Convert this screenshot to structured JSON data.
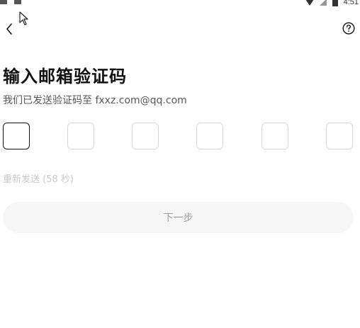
{
  "status_bar": {
    "time": "4:51",
    "left_icons": [
      "notification-icon",
      "a-icon"
    ],
    "right_icons": [
      "wifi-icon",
      "signal-icon",
      "battery-icon"
    ]
  },
  "header": {
    "back_icon": "chevron-left-icon",
    "help_icon": "help-circle-icon"
  },
  "main": {
    "title": "输入邮箱验证码",
    "subtitle": "我们已发送验证码至 fxxz.com@qq.com",
    "code_boxes": [
      "",
      "",
      "",
      "",
      "",
      ""
    ],
    "resend": "重新发送 (58 秒)",
    "next_label": "下一步"
  },
  "colors": {
    "active_border": "#111111",
    "inactive_border": "#d6d6d6",
    "button_bg": "#f6f6f6",
    "button_text": "#9a9a9a",
    "resend_text": "#c8c8c8"
  }
}
